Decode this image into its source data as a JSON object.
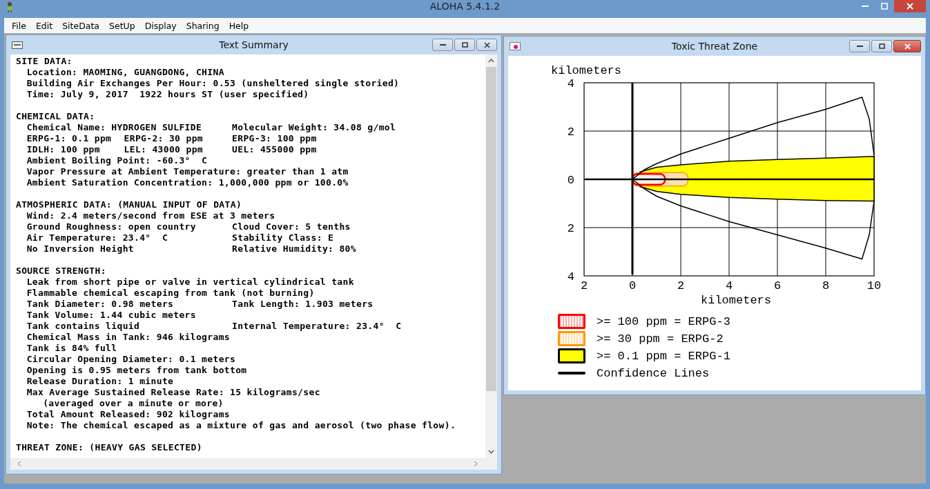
{
  "app": {
    "title": "ALOHA 5.4.1.2"
  },
  "menu": [
    "File",
    "Edit",
    "SiteData",
    "SetUp",
    "Display",
    "Sharing",
    "Help"
  ],
  "text_summary": {
    "title": "Text Summary",
    "lines": [
      {
        "kind": "heading",
        "text": "SITE DATA:"
      },
      {
        "kind": "row",
        "cells": [
          "Location: MAOMING, GUANGDONG, CHINA"
        ]
      },
      {
        "kind": "row",
        "cells": [
          "Building Air Exchanges Per Hour: 0.53 (unsheltered single storied)"
        ]
      },
      {
        "kind": "row",
        "cells": [
          "Time: July 9, 2017  1922 hours ST (user specified)"
        ]
      },
      {
        "kind": "blank"
      },
      {
        "kind": "heading",
        "text": "CHEMICAL DATA:"
      },
      {
        "kind": "row",
        "cells": [
          "Chemical Name: HYDROGEN SULFIDE",
          "Molecular Weight: 34.08 g/mol"
        ]
      },
      {
        "kind": "row",
        "cells": [
          "ERPG-1: 0.1 ppm",
          "ERPG-2: 30 ppm",
          "ERPG-3: 100 ppm"
        ]
      },
      {
        "kind": "row",
        "cells": [
          "IDLH: 100 ppm",
          "LEL: 43000 ppm",
          "UEL: 455000 ppm"
        ]
      },
      {
        "kind": "row",
        "cells": [
          "Ambient Boiling Point: -60.3°  C"
        ]
      },
      {
        "kind": "row",
        "cells": [
          "Vapor Pressure at Ambient Temperature: greater than 1 atm"
        ]
      },
      {
        "kind": "row",
        "cells": [
          "Ambient Saturation Concentration: 1,000,000 ppm or 100.0%"
        ]
      },
      {
        "kind": "blank"
      },
      {
        "kind": "heading",
        "text": "ATMOSPHERIC DATA: (MANUAL INPUT OF DATA)"
      },
      {
        "kind": "row",
        "cells": [
          "Wind: 2.4 meters/second from ESE at 3 meters"
        ]
      },
      {
        "kind": "row",
        "cells": [
          "Ground Roughness: open country",
          "Cloud Cover: 5 tenths"
        ]
      },
      {
        "kind": "row",
        "cells": [
          "Air Temperature: 23.4°  C",
          "Stability Class: E"
        ]
      },
      {
        "kind": "row",
        "cells": [
          "No Inversion Height",
          "Relative Humidity: 80%"
        ]
      },
      {
        "kind": "blank"
      },
      {
        "kind": "heading",
        "text": "SOURCE STRENGTH:"
      },
      {
        "kind": "row",
        "cells": [
          "Leak from short pipe or valve in vertical cylindrical tank"
        ]
      },
      {
        "kind": "row",
        "cells": [
          "Flammable chemical escaping from tank (not burning)"
        ]
      },
      {
        "kind": "row",
        "cells": [
          "Tank Diameter: 0.98 meters",
          "Tank Length: 1.903 meters"
        ]
      },
      {
        "kind": "row",
        "cells": [
          "Tank Volume: 1.44 cubic meters"
        ]
      },
      {
        "kind": "row",
        "cells": [
          "Tank contains liquid",
          "Internal Temperature: 23.4°  C"
        ]
      },
      {
        "kind": "row",
        "cells": [
          "Chemical Mass in Tank: 946 kilograms"
        ]
      },
      {
        "kind": "row",
        "cells": [
          "Tank is 84% full"
        ]
      },
      {
        "kind": "row",
        "cells": [
          "Circular Opening Diameter: 0.1 meters"
        ]
      },
      {
        "kind": "row",
        "cells": [
          "Opening is 0.95 meters from tank bottom"
        ]
      },
      {
        "kind": "row",
        "cells": [
          "Release Duration: 1 minute"
        ]
      },
      {
        "kind": "row",
        "cells": [
          "Max Average Sustained Release Rate: 15 kilograms/sec"
        ]
      },
      {
        "kind": "continuation",
        "text": "(averaged over a minute or more)"
      },
      {
        "kind": "row",
        "cells": [
          "Total Amount Released: 902 kilograms"
        ]
      },
      {
        "kind": "row",
        "cells": [
          "Note: The chemical escaped as a mixture of gas and aerosol (two phase flow)."
        ]
      },
      {
        "kind": "blank"
      },
      {
        "kind": "heading",
        "text": "THREAT ZONE: (HEAVY GAS SELECTED)"
      }
    ]
  },
  "threat_zone": {
    "title": "Toxic Threat Zone",
    "plot": {
      "ylabel": "kilometers",
      "yticks": [
        "4",
        "2",
        "0",
        "2",
        "4"
      ],
      "xticks": [
        "2",
        "0",
        "2",
        "4",
        "6",
        "8",
        "10"
      ],
      "xlabel": "kilometers"
    },
    "legend": [
      {
        "kind": "zone",
        "label": ">= 100 ppm = ERPG-3",
        "color": "#ff0000"
      },
      {
        "kind": "zone",
        "label": ">= 30 ppm = ERPG-2",
        "color": "#ff9900"
      },
      {
        "kind": "zone",
        "label": ">= 0.1 ppm = ERPG-1",
        "color": "#ffff00"
      },
      {
        "kind": "line",
        "label": "Confidence Lines"
      }
    ]
  }
}
